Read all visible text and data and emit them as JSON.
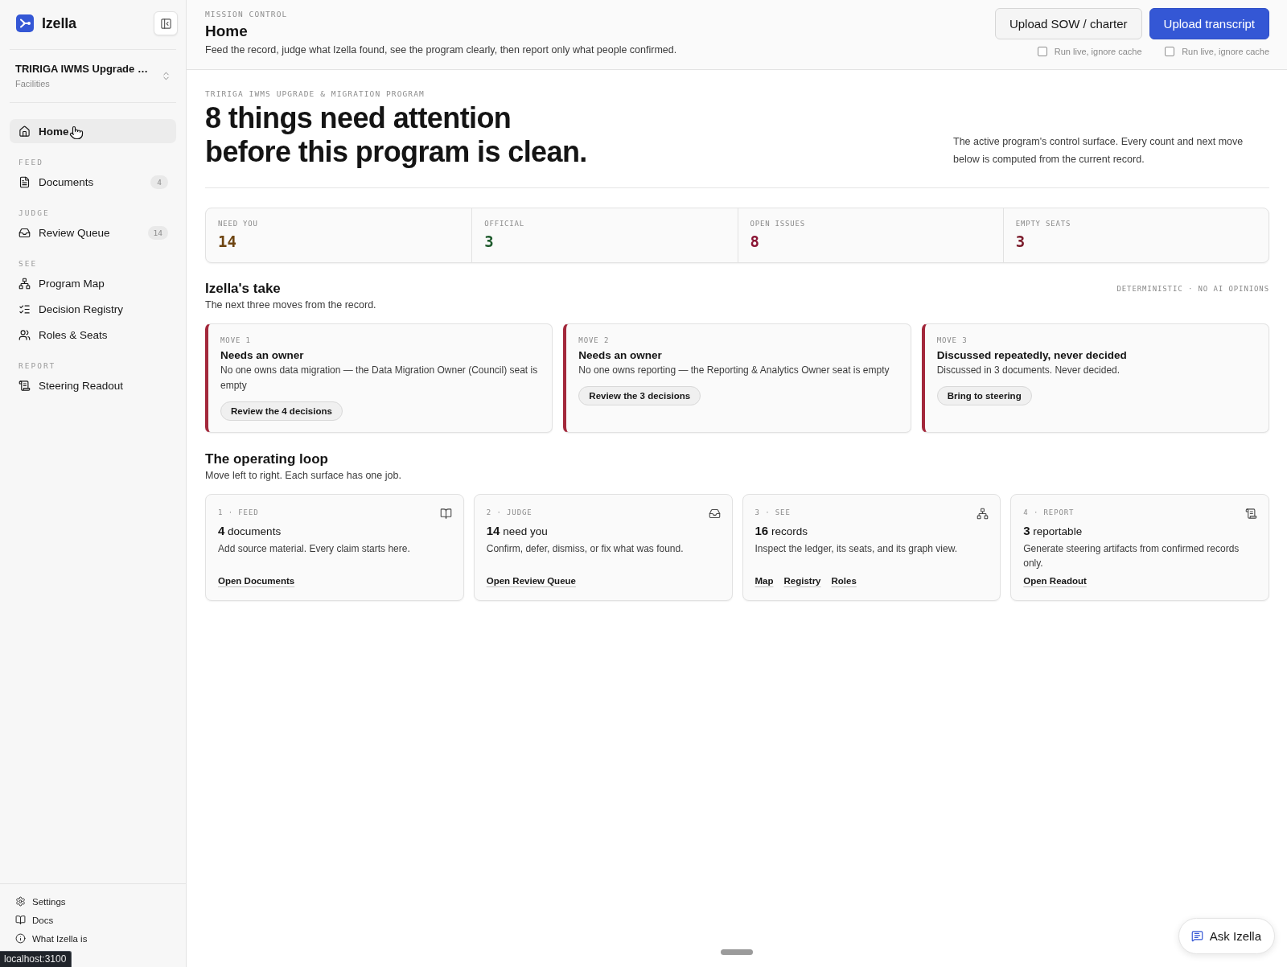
{
  "sidebar": {
    "brand": "Izella",
    "program": {
      "name": "TRIRIGA IWMS Upgrade …",
      "area": "Facilities"
    },
    "nav_groups": [
      {
        "items": [
          {
            "label": "Home",
            "selected": true
          }
        ]
      },
      {
        "heading": "FEED",
        "items": [
          {
            "label": "Documents",
            "count": "4",
            "selected": false
          }
        ]
      },
      {
        "heading": "JUDGE",
        "items": [
          {
            "label": "Review Queue",
            "count": "14",
            "selected": false
          }
        ]
      },
      {
        "heading": "SEE",
        "items": [
          {
            "label": "Program Map",
            "selected": false
          },
          {
            "label": "Decision Registry",
            "selected": false
          },
          {
            "label": "Roles & Seats",
            "selected": false
          }
        ]
      },
      {
        "heading": "REPORT",
        "items": [
          {
            "label": "Steering Readout",
            "selected": false
          }
        ]
      }
    ],
    "footer_links": [
      "Settings",
      "Docs",
      "What Izella is"
    ]
  },
  "header": {
    "eyebrow": "MISSION CONTROL",
    "title": "Home",
    "description": "Feed the record, judge what Izella found, see the program clearly, then report only what people confirmed.",
    "actions": [
      {
        "label": "Upload SOW / charter",
        "kind": "secondary",
        "option": {
          "label": "Run live, ignore cache",
          "checked": false
        }
      },
      {
        "label": "Upload transcript",
        "kind": "primary",
        "option": {
          "label": "Run live, ignore cache",
          "checked": false
        }
      }
    ]
  },
  "hero": {
    "eyebrow": "TRIRIGA IWMS UPGRADE & MIGRATION PROGRAM",
    "headline": "8 things need attention before this program is clean.",
    "summary": "The active program's control surface. Every count and next move below is computed from the current record."
  },
  "stats": [
    {
      "label": "NEED YOU",
      "value": "14",
      "color": "#6e4512"
    },
    {
      "label": "OFFICIAL",
      "value": "3",
      "color": "#1e5a2c"
    },
    {
      "label": "OPEN ISSUES",
      "value": "8",
      "color": "#8a1434"
    },
    {
      "label": "EMPTY SEATS",
      "value": "3",
      "color": "#7a1a2a"
    }
  ],
  "take": {
    "title": "Izella's take",
    "subtitle": "The next three moves from the record.",
    "tag": "DETERMINISTIC · NO AI OPINIONS",
    "moves": [
      {
        "eyebrow": "MOVE 1",
        "title": "Needs an owner",
        "description": "No one owns data migration — the Data Migration Owner (Council) seat is empty",
        "action": "Review the 4 decisions"
      },
      {
        "eyebrow": "MOVE 2",
        "title": "Needs an owner",
        "description": "No one owns reporting — the Reporting & Analytics Owner seat is empty",
        "action": "Review the 3 decisions"
      },
      {
        "eyebrow": "MOVE 3",
        "title": "Discussed repeatedly, never decided",
        "description": "Discussed in 3 documents. Never decided.",
        "action": "Bring to steering"
      }
    ]
  },
  "loop": {
    "title": "The operating loop",
    "subtitle": "Move left to right. Each surface has one job.",
    "steps": [
      {
        "eyebrow": "1 · FEED",
        "count": "**4** documents",
        "description": "Add source material. Every claim starts here.",
        "links": [
          "Open Documents"
        ]
      },
      {
        "eyebrow": "2 · JUDGE",
        "count": "**14** need you",
        "description": "Confirm, defer, dismiss, or fix what was found.",
        "links": [
          "Open Review Queue"
        ]
      },
      {
        "eyebrow": "3 · SEE",
        "count": "**16** records",
        "description": "Inspect the ledger, its seats, and its graph view.",
        "links": [
          "Map",
          "Registry",
          "Roles"
        ]
      },
      {
        "eyebrow": "4 · REPORT",
        "count": "**3** reportable",
        "description": "Generate steering artifacts from confirmed records only.",
        "links": [
          "Open Readout"
        ]
      }
    ]
  },
  "ask_button": "Ask Izella",
  "browser_status": "localhost:3100"
}
